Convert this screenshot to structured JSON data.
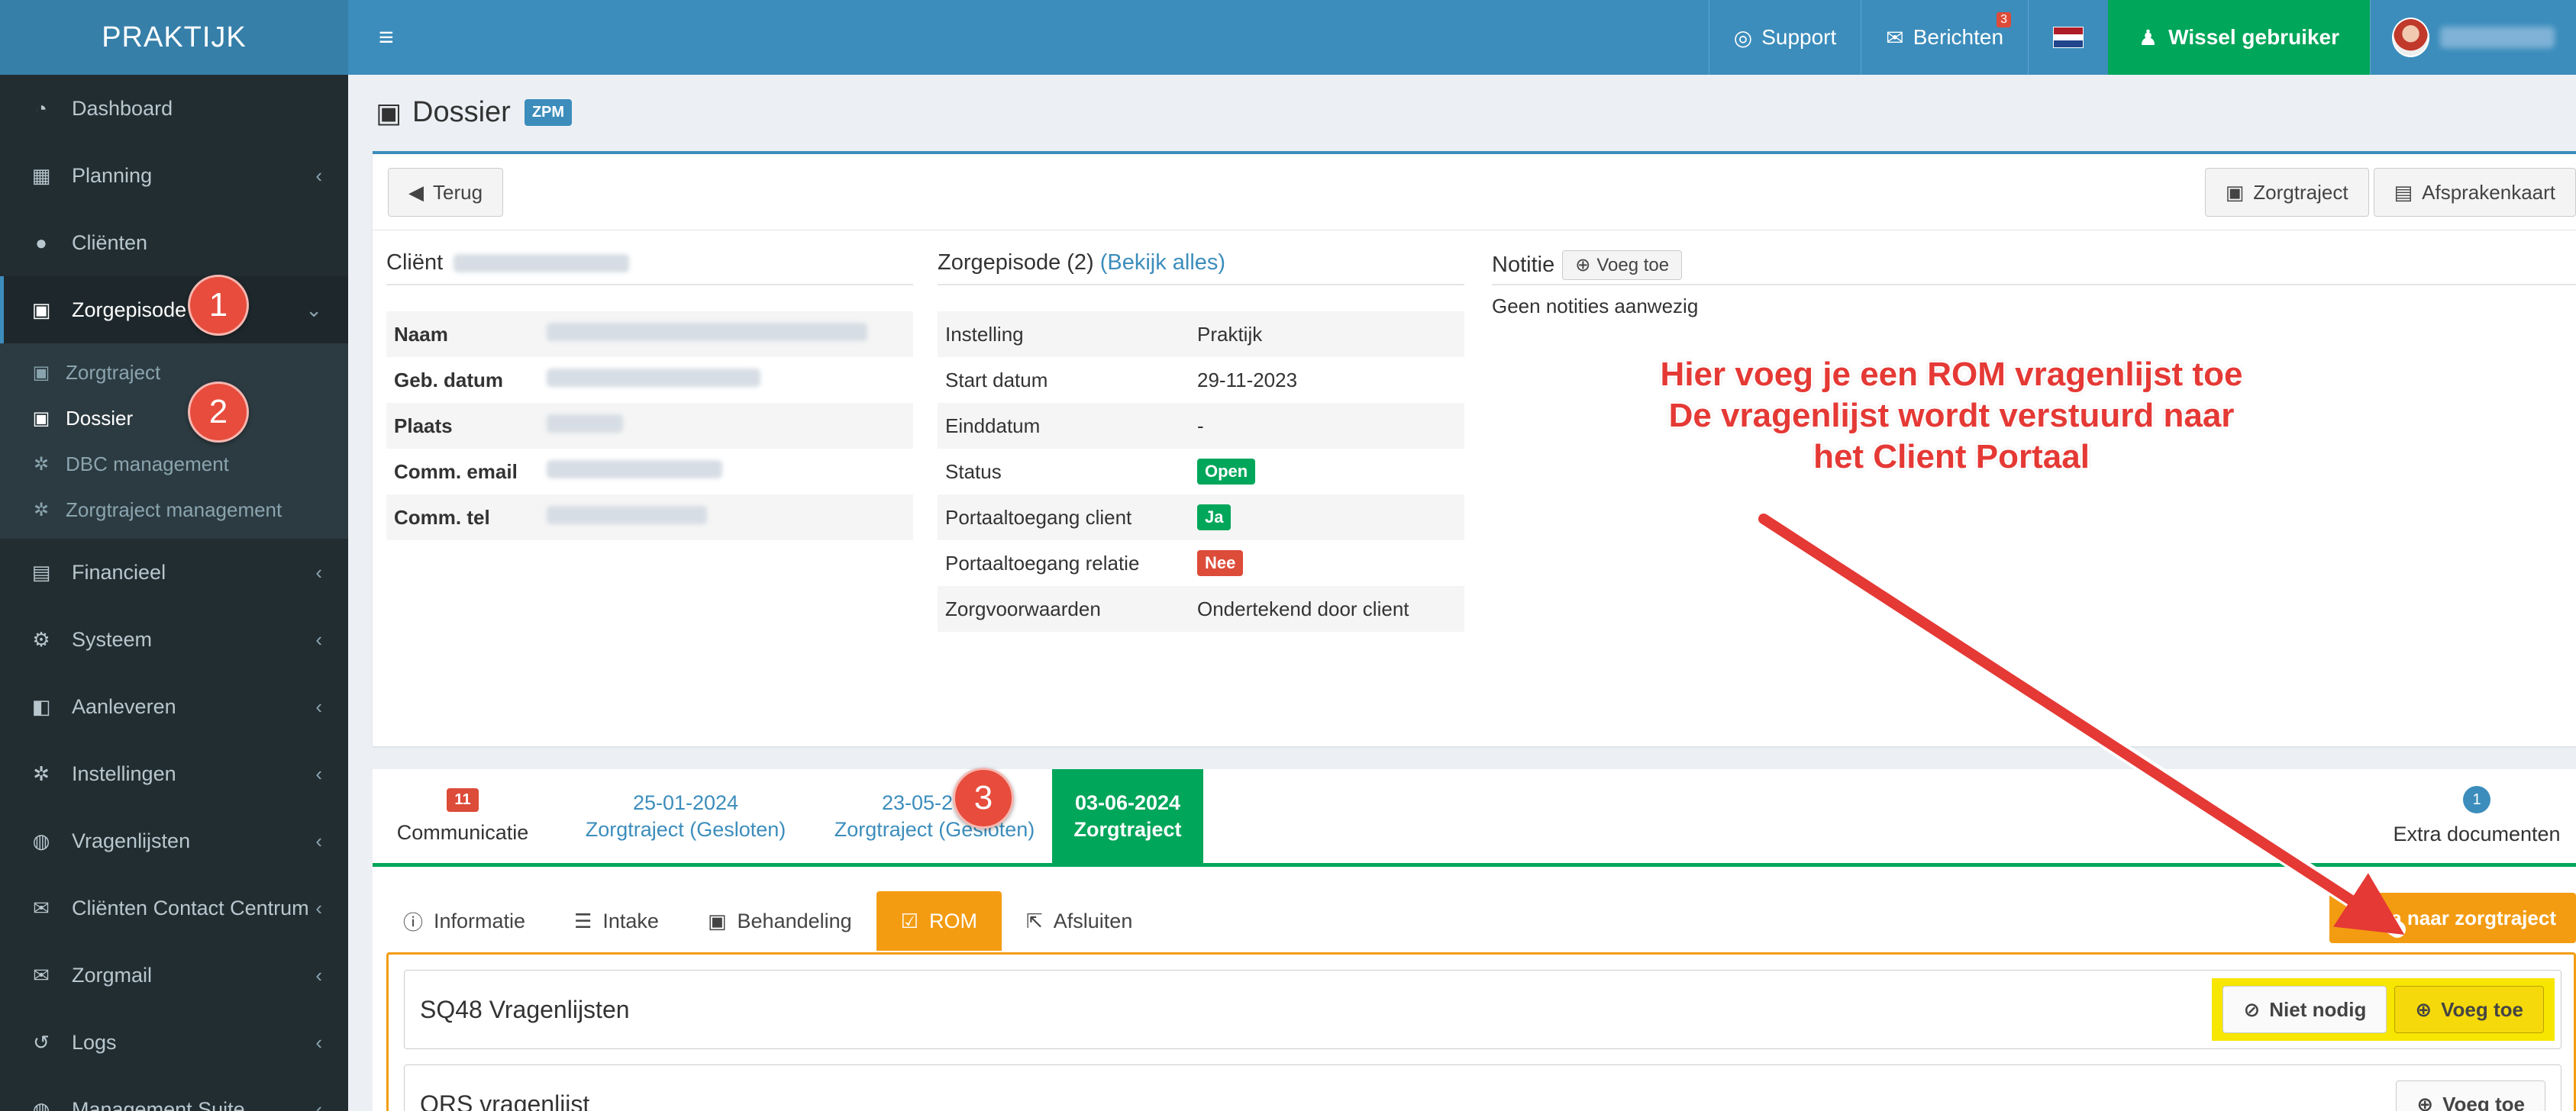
{
  "app": {
    "brand": "PRAKTIJK"
  },
  "sidebar": {
    "items": [
      {
        "label": "Dashboard",
        "icon": "dashboard-icon"
      },
      {
        "label": "Planning",
        "icon": "calendar-icon"
      },
      {
        "label": "Cliënten",
        "icon": "user-icon"
      },
      {
        "label": "Zorgepisode",
        "icon": "medkit-icon"
      },
      {
        "label": "Financieel",
        "icon": "book-icon"
      },
      {
        "label": "Systeem",
        "icon": "cogs-icon"
      },
      {
        "label": "Aanleveren",
        "icon": "truck-icon"
      },
      {
        "label": "Instellingen",
        "icon": "gear-icon"
      },
      {
        "label": "Vragenlijsten",
        "icon": "globe-icon"
      },
      {
        "label": "Cliënten Contact Centrum",
        "icon": "envelope-icon"
      },
      {
        "label": "Zorgmail",
        "icon": "envelope-icon"
      },
      {
        "label": "Logs",
        "icon": "history-icon"
      },
      {
        "label": "Management Suite",
        "icon": "globe-icon"
      }
    ],
    "submenu": [
      {
        "label": "Zorgtraject"
      },
      {
        "label": "Dossier"
      },
      {
        "label": "DBC management"
      },
      {
        "label": "Zorgtraject management"
      }
    ]
  },
  "steps": [
    "1",
    "2",
    "3"
  ],
  "topbar": {
    "support": "Support",
    "messages": "Berichten",
    "messages_count": "3",
    "switch_user": "Wissel gebruiker",
    "flag_colors": [
      "#ae1c28",
      "#ffffff",
      "#21468b"
    ]
  },
  "page": {
    "title": "Dossier",
    "badge": "ZPM"
  },
  "buttons": {
    "back": "Terug",
    "zorgtraject": "Zorgtraject",
    "afsprakenkaart": "Afsprakenkaart"
  },
  "client": {
    "title": "Cliënt",
    "rows": [
      {
        "key": "Naam"
      },
      {
        "key": "Geb. datum"
      },
      {
        "key": "Plaats"
      },
      {
        "key": "Comm. email"
      },
      {
        "key": "Comm. tel"
      }
    ]
  },
  "episode": {
    "title": "Zorgepisode (2)",
    "link": "(Bekijk alles)",
    "rows": [
      {
        "key": "Instelling",
        "value": "Praktijk"
      },
      {
        "key": "Start datum",
        "value": "29-11-2023"
      },
      {
        "key": "Einddatum",
        "value": "-"
      },
      {
        "key": "Status",
        "value": "Open",
        "tag": "green"
      },
      {
        "key": "Portaaltoegang client",
        "value": "Ja",
        "tag": "green"
      },
      {
        "key": "Portaaltoegang relatie",
        "value": "Nee",
        "tag": "red"
      },
      {
        "key": "Zorgvoorwaarden",
        "value": "Ondertekend door client"
      }
    ]
  },
  "note": {
    "title": "Notitie",
    "add": "Voeg toe",
    "empty": "Geen notities aanwezig"
  },
  "annotation": {
    "lines": [
      "Hier voeg je een ROM vragenlijst toe",
      "De vragenlijst wordt verstuurd naar",
      "het Client Portaal"
    ],
    "color": "#e53935"
  },
  "episode_tabs": [
    {
      "count": "11",
      "label": "Communicatie"
    },
    {
      "date": "25-01-2024",
      "label": "Zorgtraject (Gesloten)"
    },
    {
      "date": "23-05-2024",
      "label": "Zorgtraject (Gesloten)"
    },
    {
      "date": "03-06-2024",
      "label": "Zorgtraject"
    },
    {
      "count": "1",
      "label": "Extra documenten"
    }
  ],
  "sub_tabs": [
    {
      "label": "Informatie",
      "icon": "info-icon"
    },
    {
      "label": "Intake",
      "icon": "sliders-icon"
    },
    {
      "label": "Behandeling",
      "icon": "medkit-icon"
    },
    {
      "label": "ROM",
      "icon": "check-square-icon"
    },
    {
      "label": "Afsluiten",
      "icon": "external-link-icon"
    }
  ],
  "goto_button": "Ga naar zorgtraject",
  "rom": {
    "rows": [
      {
        "name": "SQ48 Vragenlijsten",
        "not_needed": "Niet nodig",
        "add": "Voeg toe"
      },
      {
        "name": "ORS vragenlijst",
        "add": "Voeg toe"
      }
    ]
  }
}
